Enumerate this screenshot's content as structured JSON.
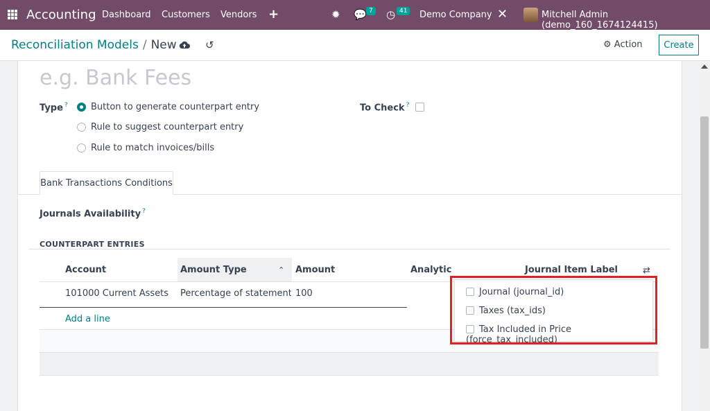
{
  "navbar": {
    "app_name": "Accounting",
    "menu": [
      "Dashboard",
      "Customers",
      "Vendors"
    ],
    "messages_count": "7",
    "activities_count": "41",
    "company": "Demo Company",
    "user": "Mitchell Admin (demo_160_1674124415)"
  },
  "control": {
    "breadcrumb_parent": "Reconciliation Models",
    "breadcrumb_current": "New",
    "action_label": "Action",
    "create_label": "Create"
  },
  "form": {
    "name_placeholder": "e.g. Bank Fees",
    "type_label": "Type",
    "type_help": "?",
    "type_options": [
      "Button to generate counterpart entry",
      "Rule to suggest counterpart entry",
      "Rule to match invoices/bills"
    ],
    "type_selected": "Button to generate counterpart entry",
    "to_check_label": "To Check",
    "to_check_help": "?",
    "tab_label": "Bank Transactions Conditions",
    "journals_label": "Journals Availability",
    "journals_help": "?",
    "section_title": "COUNTERPART ENTRIES"
  },
  "table": {
    "columns": [
      "Account",
      "Amount Type",
      "Amount",
      "Analytic",
      "Journal Item Label"
    ],
    "rows": [
      {
        "account": "101000 Current Assets",
        "amount_type": "Percentage of statement line",
        "amount": "100"
      }
    ],
    "add_line": "Add a line"
  },
  "optional_columns": [
    "Journal (journal_id)",
    "Taxes (tax_ids)",
    "Tax Included in Price (force_tax_included)"
  ],
  "colors": {
    "navbar": "#714b67",
    "accent": "#017e84",
    "badge": "#00a09d",
    "highlight": "#e31e24"
  }
}
